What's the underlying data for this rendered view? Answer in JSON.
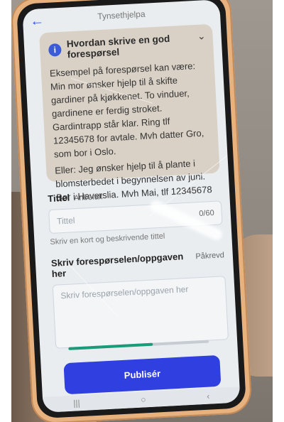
{
  "app": {
    "title": "Tynsethjelpa"
  },
  "info": {
    "title": "Hvordan skrive en god forespørsel",
    "paragraph1": "Eksempel på forespørsel kan være: Min mor ønsker hjelp til å skifte gardiner på kjøkkenet. To vinduer, gardinene er ferdig stroket. Gardintrapp står klar. Ring tlf 12345678 for avtale. Mvh datter Gro, som bor i Oslo.",
    "paragraph2": "Eller: Jeg ønsker hjelp til å plante i blomsterbedet i begynnelsen av juni. Bor i Haverslia. Mvh Mai, tlf 12345678"
  },
  "form": {
    "title_label": "Tittel",
    "title_hint": "Anbefalt",
    "title_placeholder": "Tittel",
    "title_counter": "0/60",
    "title_helper": "Skriv en kort og beskrivende tittel",
    "desc_label": "Skriv forespørselen/oppgaven her",
    "desc_hint": "Påkrevd",
    "desc_placeholder": "Skriv forespørselen/oppgaven her"
  },
  "progress": {
    "value": 0.6
  },
  "actions": {
    "publish_label": "Publisér"
  },
  "colors": {
    "accent": "#2f3fe0",
    "progress": "#1a9c7a",
    "info_bg": "#d9d1c6"
  }
}
